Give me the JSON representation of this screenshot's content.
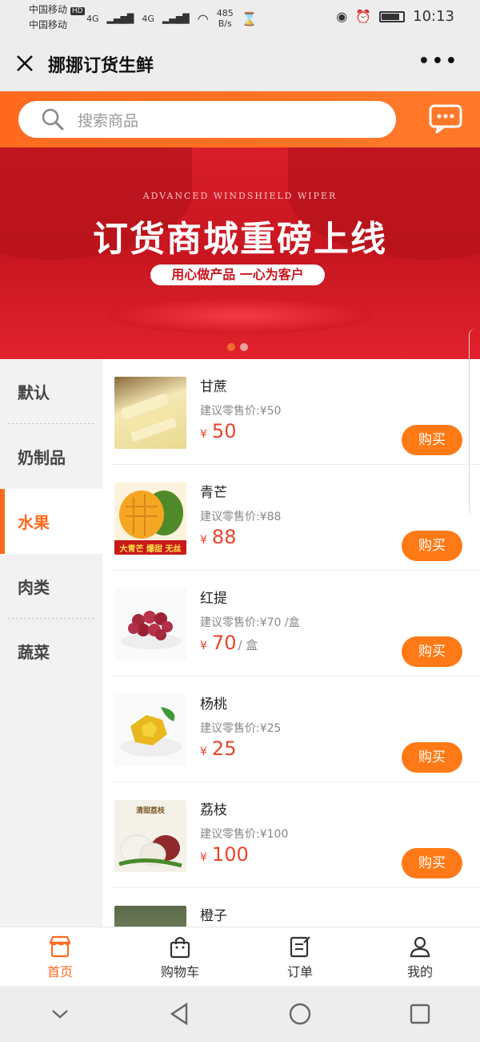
{
  "status": {
    "carrier1": "中国移动",
    "carrier2": "中国移动",
    "hd": "HD",
    "net1": "4G",
    "net2": "4G",
    "speed_value": "485",
    "speed_unit": "B/s",
    "time": "10:13"
  },
  "titlebar": {
    "title": "挪挪订货生鲜"
  },
  "search": {
    "placeholder": "搜索商品"
  },
  "banner": {
    "english": "ADVANCED WINDSHIELD WIPER",
    "headline": "订货商城重磅上线",
    "subline": "用心做产品 一心为客户",
    "slide_count": 2,
    "active_slide": 1
  },
  "categories": [
    {
      "label": "默认"
    },
    {
      "label": "奶制品"
    },
    {
      "label": "水果"
    },
    {
      "label": "肉类"
    },
    {
      "label": "蔬菜"
    }
  ],
  "active_category": "水果",
  "products": [
    {
      "name": "甘蔗",
      "suggest": "建议零售价:¥50",
      "currency": "¥",
      "price": "50",
      "unit": "",
      "buy": "购买",
      "thumb_color": "#f0e3a2"
    },
    {
      "name": "青芒",
      "suggest": "建议零售价:¥88",
      "currency": "¥",
      "price": "88",
      "unit": "",
      "buy": "购买",
      "thumb_color": "#f3b92b",
      "thumb_caption": "大青芒 爆甜 无丝"
    },
    {
      "name": "红提",
      "suggest": "建议零售价:¥70 /盒",
      "currency": "¥",
      "price": "70",
      "unit": "/ 盒",
      "buy": "购买",
      "thumb_color": "#a5283d"
    },
    {
      "name": "杨桃",
      "suggest": "建议零售价:¥25",
      "currency": "¥",
      "price": "25",
      "unit": "",
      "buy": "购买",
      "thumb_color": "#e8b81e"
    },
    {
      "name": "荔枝",
      "suggest": "建议零售价:¥100",
      "currency": "¥",
      "price": "100",
      "unit": "",
      "buy": "购买",
      "thumb_color": "#e7e4dc",
      "thumb_caption": "清甜荔枝"
    },
    {
      "name": "橙子",
      "suggest": "",
      "currency": "",
      "price": "",
      "unit": "",
      "buy": "",
      "thumb_color": "#6d7a5a"
    }
  ],
  "tabbar": [
    {
      "label": "首页",
      "icon": "shop-icon",
      "active": true
    },
    {
      "label": "购物车",
      "icon": "bag-icon",
      "active": false
    },
    {
      "label": "订单",
      "icon": "order-icon",
      "active": false
    },
    {
      "label": "我的",
      "icon": "user-icon",
      "active": false
    }
  ],
  "colors": {
    "accent": "#ff6a1e",
    "price": "#e6452a",
    "banner": "#d81e2a"
  }
}
